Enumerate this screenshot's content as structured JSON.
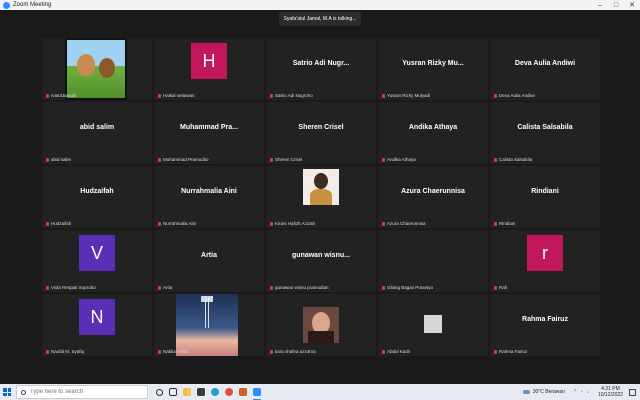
{
  "window": {
    "title": "Zoom Meeting"
  },
  "talking_indicator": "Syafa'atul Jamal, M.A is talking...",
  "tiles": [
    {
      "name": "IvatulJannah",
      "display": "photo",
      "photo": "cartoon"
    },
    {
      "name": "Haikal setiawan",
      "display": "initial",
      "initial": "H",
      "color": "#c2185b"
    },
    {
      "name": "Satrio Adi Nugroho",
      "display": "text",
      "big": "Satrio Adi Nugr..."
    },
    {
      "name": "Yusran Rizky Mulyadi",
      "display": "text",
      "big": "Yusran Rizky Mu..."
    },
    {
      "name": "Deva Aulia Andiwi",
      "display": "text",
      "big": "Deva Aulia Andiwi"
    },
    {
      "name": "abid salim",
      "display": "text",
      "big": "abid salim"
    },
    {
      "name": "Muhammad Pramudito",
      "display": "text",
      "big": "Muhammad Pra..."
    },
    {
      "name": "Sheren Crisel",
      "display": "text",
      "big": "Sheren Crisel"
    },
    {
      "name": "Andika Athaya",
      "display": "text",
      "big": "Andika Athaya"
    },
    {
      "name": "Calista Salsabila",
      "display": "text",
      "big": "Calista Salsabila"
    },
    {
      "name": "Hudzaifah",
      "display": "text",
      "big": "Hudzaifah"
    },
    {
      "name": "Nurrahmalia Aini",
      "display": "text",
      "big": "Nurrahmalia Aini"
    },
    {
      "name": "Kirani Hafizh Azizah",
      "display": "photo",
      "photo": "portrait-light"
    },
    {
      "name": "Azura Chaerunnisa",
      "display": "text",
      "big": "Azura Chaerunnisa"
    },
    {
      "name": "Rindiani",
      "display": "text",
      "big": "Rindiani"
    },
    {
      "name": "Viola Respati Suprobo",
      "display": "initial",
      "initial": "V",
      "color": "#5b2fb5"
    },
    {
      "name": "Artia",
      "display": "text",
      "big": "Artia"
    },
    {
      "name": "gunawan wisnu pramudian",
      "display": "text",
      "big": "gunawan wisnu..."
    },
    {
      "name": "Gilang Bagas Prasetyo",
      "display": "none"
    },
    {
      "name": "Rafi",
      "display": "initial",
      "initial": "r",
      "color": "#c2185b"
    },
    {
      "name": "Naufal M. Syafiq",
      "display": "initial",
      "initial": "N",
      "color": "#5b2fb5"
    },
    {
      "name": "Nabila Amira",
      "display": "photo",
      "photo": "sky"
    },
    {
      "name": "tiara shafira azzahra",
      "display": "photo",
      "photo": "portrait-dark"
    },
    {
      "name": "Abdul Kadir",
      "display": "photo",
      "photo": "blank"
    },
    {
      "name": "Rahma Fairuz",
      "display": "text",
      "big": "Rahma Fairuz"
    }
  ],
  "taskbar": {
    "search_placeholder": "Type here to search",
    "weather": "30°C  Berawan",
    "time": "4:21 PM",
    "date": "10/12/2022"
  }
}
